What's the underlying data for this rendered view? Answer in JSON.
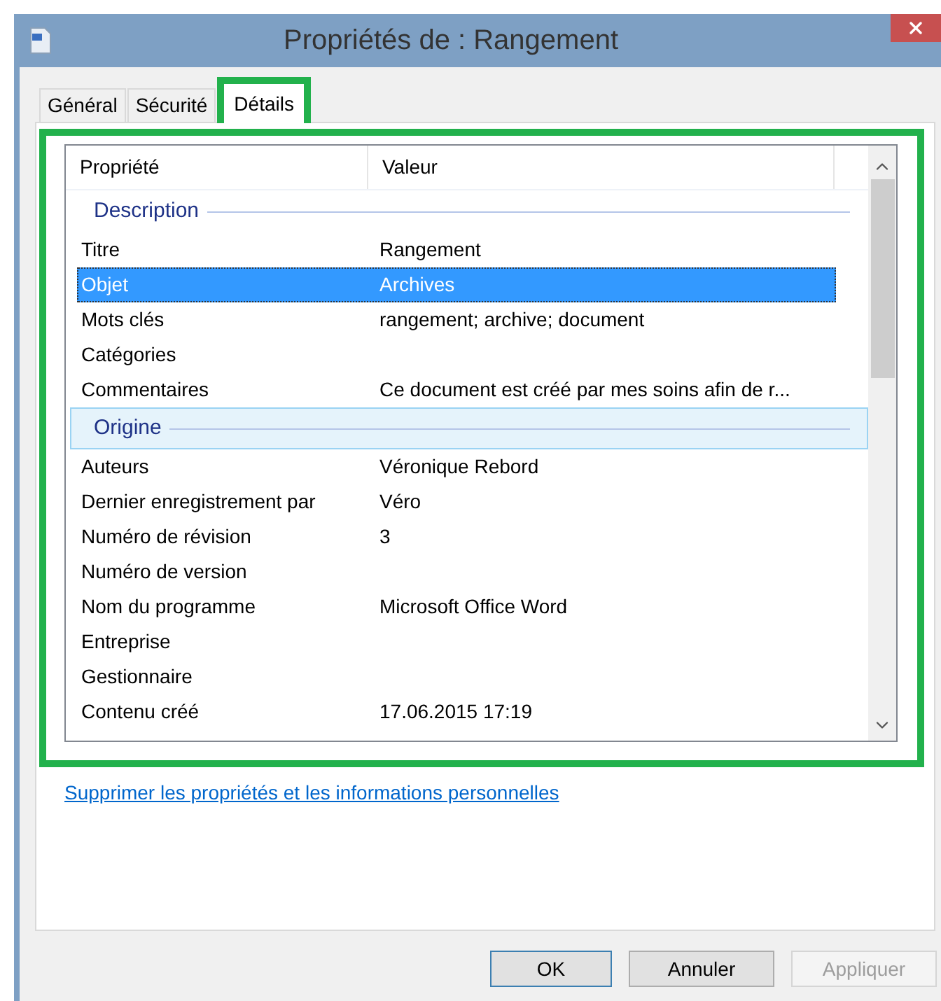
{
  "window": {
    "title": "Propriétés de : Rangement"
  },
  "tabs": [
    {
      "label": "Général",
      "selected": false
    },
    {
      "label": "Sécurité",
      "selected": false
    },
    {
      "label": "Détails",
      "selected": true
    }
  ],
  "table": {
    "columns": [
      "Propriété",
      "Valeur"
    ],
    "groups": [
      {
        "title": "Description",
        "highlighted": false,
        "rows": [
          {
            "property": "Titre",
            "value": "Rangement",
            "selected": false
          },
          {
            "property": "Objet",
            "value": "Archives",
            "selected": true
          },
          {
            "property": "Mots clés",
            "value": "rangement; archive; document",
            "selected": false
          },
          {
            "property": "Catégories",
            "value": "",
            "selected": false
          },
          {
            "property": "Commentaires",
            "value": "Ce document est créé par mes soins afin de r...",
            "selected": false
          }
        ]
      },
      {
        "title": "Origine",
        "highlighted": true,
        "rows": [
          {
            "property": "Auteurs",
            "value": "Véronique Rebord",
            "selected": false
          },
          {
            "property": "Dernier enregistrement par",
            "value": "Véro",
            "selected": false
          },
          {
            "property": "Numéro de révision",
            "value": "3",
            "selected": false
          },
          {
            "property": "Numéro de version",
            "value": "",
            "selected": false
          },
          {
            "property": "Nom du programme",
            "value": "Microsoft Office Word",
            "selected": false
          },
          {
            "property": "Entreprise",
            "value": "",
            "selected": false
          },
          {
            "property": "Gestionnaire",
            "value": "",
            "selected": false
          },
          {
            "property": "Contenu créé",
            "value": "17.06.2015 17:19",
            "selected": false
          }
        ]
      }
    ]
  },
  "link": "Supprimer les propriétés et les informations personnelles",
  "buttons": [
    {
      "label": "OK",
      "kind": "default",
      "disabled": false
    },
    {
      "label": "Annuler",
      "kind": "normal",
      "disabled": false
    },
    {
      "label": "Appliquer",
      "kind": "normal",
      "disabled": true
    }
  ]
}
